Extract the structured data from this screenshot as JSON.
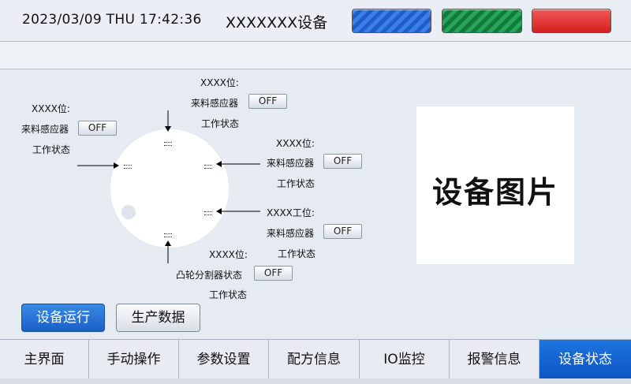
{
  "header": {
    "datetime": "2023/03/09 THU 17:42:36",
    "device_name": "XXXXXXX设备",
    "lamp_colors": [
      "#2f6fd8",
      "#1f8f4a",
      "#e03a3a"
    ]
  },
  "stations": {
    "left": {
      "title": "XXXX位:",
      "sensor_label": "来料感应器",
      "sensor_value": "OFF",
      "status": "工作状态"
    },
    "top": {
      "title": "XXXX位:",
      "sensor_label": "来料感应器",
      "sensor_value": "OFF",
      "status": "工作状态"
    },
    "right1": {
      "title": "XXXX位:",
      "sensor_label": "来料感应器",
      "sensor_value": "OFF",
      "status": "工作状态"
    },
    "right2": {
      "title": "XXXX工位:",
      "sensor_label": "来料感应器",
      "sensor_value": "OFF",
      "status": "工作状态"
    },
    "bottom": {
      "title": "XXXX位:",
      "sensor_label": "凸轮分割器状态",
      "sensor_value": "OFF",
      "status": "工作状态"
    }
  },
  "image_box": {
    "label": "设备图片"
  },
  "actions": {
    "run_label": "设备运行",
    "production_label": "生产数据"
  },
  "nav": {
    "tabs": [
      {
        "label": "主界面",
        "active": false
      },
      {
        "label": "手动操作",
        "active": false
      },
      {
        "label": "参数设置",
        "active": false
      },
      {
        "label": "配方信息",
        "active": false
      },
      {
        "label": "IO监控",
        "active": false
      },
      {
        "label": "报警信息",
        "active": false
      },
      {
        "label": "设备状态",
        "active": true
      }
    ]
  }
}
